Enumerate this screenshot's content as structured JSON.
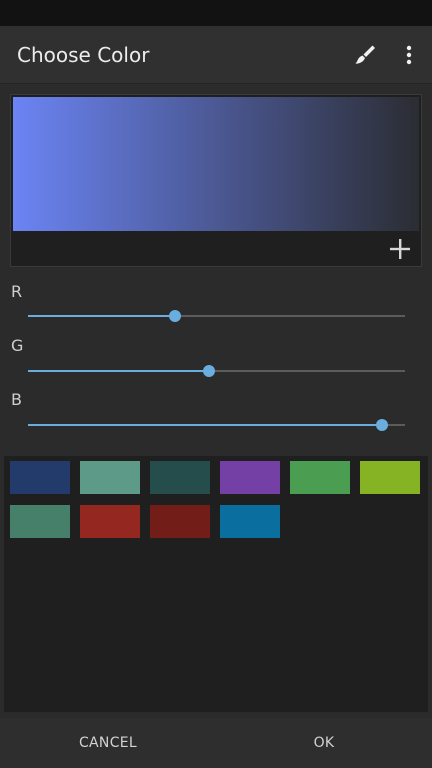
{
  "app_bar": {
    "title": "Choose Color",
    "brush_icon": "paintbrush-icon",
    "more_icon": "more-vertical-icon"
  },
  "preview": {
    "gradient_start": "#6b84f4",
    "gradient_end": "#2b2d33",
    "add_icon": "plus-icon"
  },
  "sliders": [
    {
      "label": "R",
      "value": 0.39,
      "color": "#6aaee0"
    },
    {
      "label": "G",
      "value": 0.48,
      "color": "#6aaee0"
    },
    {
      "label": "B",
      "value": 0.94,
      "color": "#6aaee0"
    }
  ],
  "swatches": [
    "#233b6a",
    "#5e9a88",
    "#244d4b",
    "#7540a6",
    "#4b9d52",
    "#86b324",
    "#46806a",
    "#94271f",
    "#731d18",
    "#0a6f9e"
  ],
  "buttons": {
    "cancel": "CANCEL",
    "ok": "OK"
  }
}
